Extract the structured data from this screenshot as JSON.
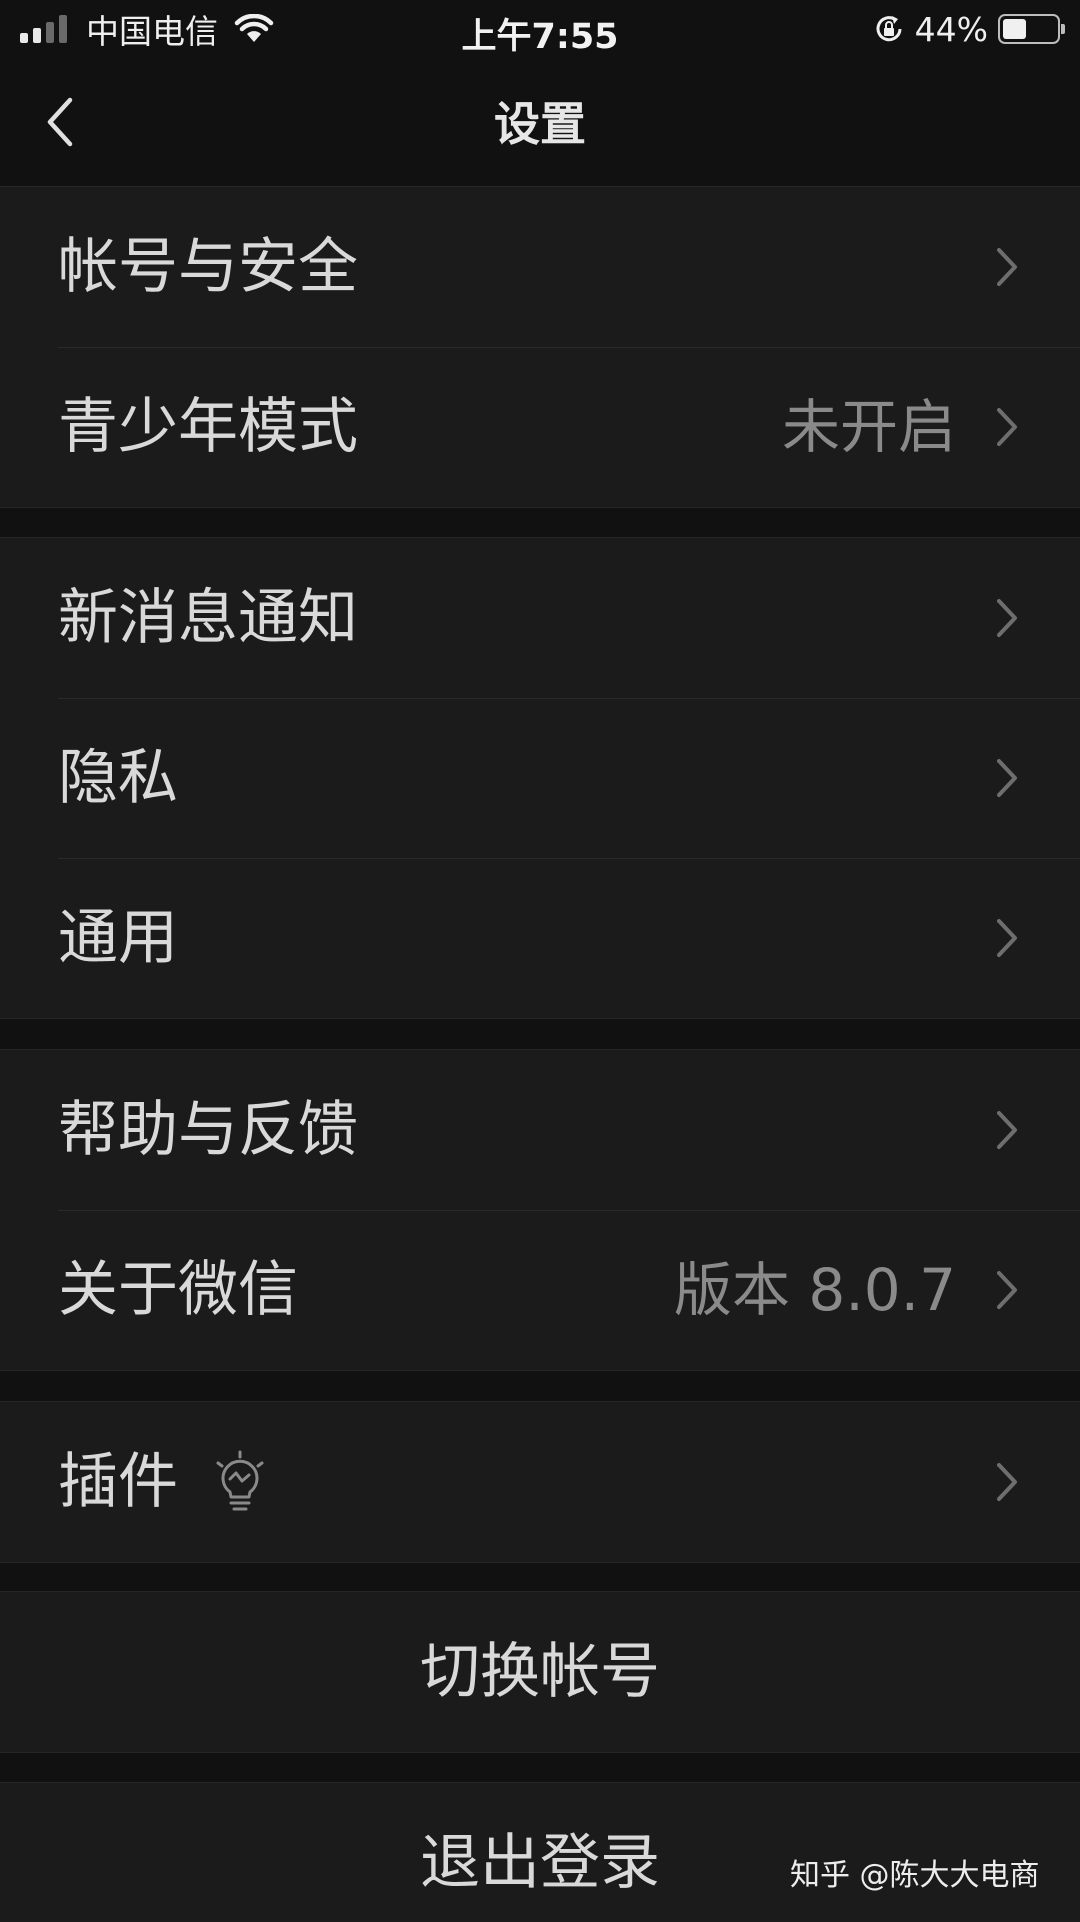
{
  "status_bar": {
    "carrier": "中国电信",
    "time": "上午7:55",
    "battery_percent": "44%",
    "battery_level": 0.44,
    "signal_bars": 2,
    "icons": [
      "signal-icon",
      "wifi-icon",
      "orientation-lock-icon",
      "battery-icon"
    ]
  },
  "nav": {
    "title": "设置",
    "back_icon": "chevron-left-icon"
  },
  "groups": [
    {
      "items": [
        {
          "label": "帐号与安全",
          "value": ""
        },
        {
          "label": "青少年模式",
          "value": "未开启"
        }
      ]
    },
    {
      "items": [
        {
          "label": "新消息通知",
          "value": ""
        },
        {
          "label": "隐私",
          "value": ""
        },
        {
          "label": "通用",
          "value": ""
        }
      ]
    },
    {
      "items": [
        {
          "label": "帮助与反馈",
          "value": ""
        },
        {
          "label": "关于微信",
          "value": "版本 8.0.7"
        }
      ]
    },
    {
      "items": [
        {
          "label": "插件",
          "value": "",
          "icon": "lightbulb-icon"
        }
      ]
    }
  ],
  "actions": {
    "switch_account": "切换帐号",
    "logout": "退出登录"
  },
  "watermark": "知乎 @陈大大电商",
  "colors": {
    "background": "#111111",
    "cell": "#1b1b1b",
    "text": "#d9d9d9",
    "secondary_text": "#8a8a8a"
  }
}
